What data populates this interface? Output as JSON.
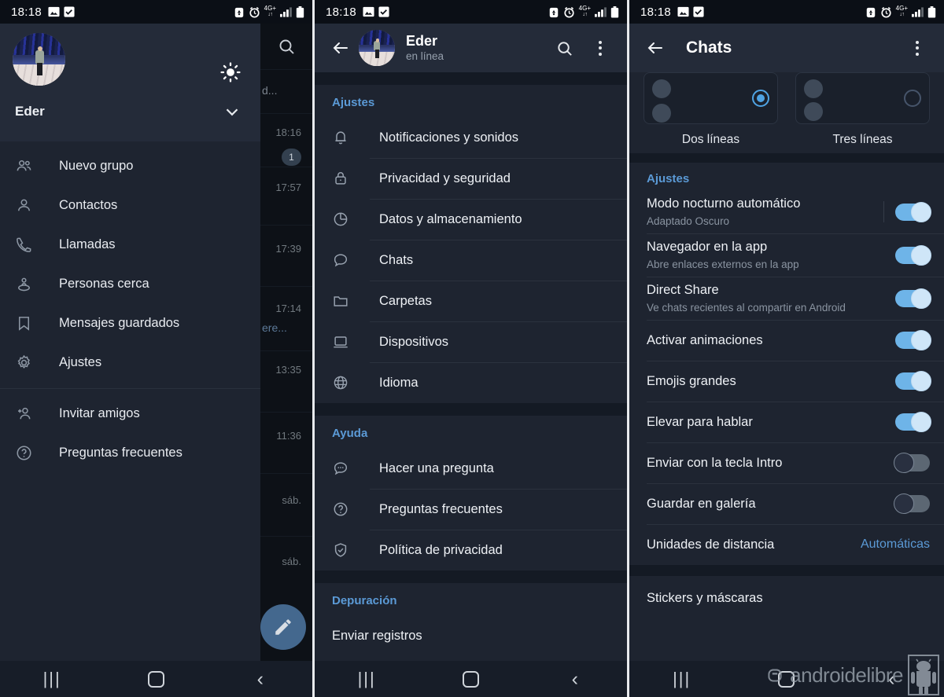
{
  "statusbar": {
    "time": "18:18",
    "left_icons": [
      "image-icon",
      "checkbox-icon"
    ],
    "right_icons": [
      "alarm-silent-icon",
      "alarm-icon",
      "mobile-data-icon",
      "signal-icon",
      "battery-icon"
    ],
    "network_label": "4G+"
  },
  "panel1": {
    "drawer": {
      "user_name": "Eder",
      "brightness_icon": "brightness-icon",
      "expand_icon": "chevron-down-icon",
      "avatar": "user-avatar",
      "items": [
        {
          "label": "Nuevo grupo",
          "icon": "group-icon"
        },
        {
          "label": "Contactos",
          "icon": "person-icon"
        },
        {
          "label": "Llamadas",
          "icon": "phone-icon"
        },
        {
          "label": "Personas cerca",
          "icon": "nearby-people-icon"
        },
        {
          "label": "Mensajes guardados",
          "icon": "bookmark-icon"
        },
        {
          "label": "Ajustes",
          "icon": "gear-icon"
        }
      ],
      "items_secondary": [
        {
          "label": "Invitar amigos",
          "icon": "person-add-icon"
        },
        {
          "label": "Preguntas frecuentes",
          "icon": "question-circle-icon"
        }
      ]
    },
    "chat_strip": {
      "search_icon": "search-icon",
      "rows": [
        {
          "time": "",
          "snippet": "d...",
          "badge": ""
        },
        {
          "time": "18:16",
          "snippet": "",
          "badge": "1"
        },
        {
          "time": "17:57",
          "snippet": "",
          "badge": ""
        },
        {
          "time": "17:39",
          "snippet": "",
          "badge": ""
        },
        {
          "time": "17:14",
          "snippet": "ere...",
          "badge": ""
        },
        {
          "time": "13:35",
          "snippet": "",
          "badge": ""
        },
        {
          "time": "11:36",
          "snippet": "",
          "badge": ""
        },
        {
          "time": "sáb.",
          "snippet": "",
          "badge": ""
        },
        {
          "time": "sáb.",
          "snippet": "",
          "badge": ""
        }
      ],
      "fab_icon": "compose-pencil-icon"
    }
  },
  "panel2": {
    "header": {
      "back_icon": "back-arrow-icon",
      "title": "Eder",
      "subtitle": "en línea",
      "search_icon": "search-icon",
      "menu_icon": "overflow-menu-icon"
    },
    "sections": [
      {
        "title": "Ajustes",
        "items": [
          {
            "label": "Notificaciones y sonidos",
            "icon": "bell-icon"
          },
          {
            "label": "Privacidad y seguridad",
            "icon": "lock-icon"
          },
          {
            "label": "Datos y almacenamiento",
            "icon": "pie-chart-icon"
          },
          {
            "label": "Chats",
            "icon": "chat-bubble-icon"
          },
          {
            "label": "Carpetas",
            "icon": "folder-icon"
          },
          {
            "label": "Dispositivos",
            "icon": "laptop-icon"
          },
          {
            "label": "Idioma",
            "icon": "globe-icon"
          }
        ]
      },
      {
        "title": "Ayuda",
        "items": [
          {
            "label": "Hacer una pregunta",
            "icon": "chat-dots-icon"
          },
          {
            "label": "Preguntas frecuentes",
            "icon": "question-circle-icon"
          },
          {
            "label": "Política de privacidad",
            "icon": "shield-check-icon"
          }
        ]
      },
      {
        "title": "Depuración",
        "items": [
          {
            "label": "Enviar registros",
            "icon": ""
          }
        ]
      }
    ]
  },
  "panel3": {
    "header": {
      "back_icon": "back-arrow-icon",
      "title": "Chats",
      "menu_icon": "overflow-menu-icon"
    },
    "chat_preview": {
      "options": [
        {
          "label": "Dos líneas",
          "selected": true,
          "lines": 2
        },
        {
          "label": "Tres líneas",
          "selected": false,
          "lines": 3
        }
      ]
    },
    "settings": {
      "title": "Ajustes",
      "rows": [
        {
          "label": "Modo nocturno automático",
          "sub": "Adaptado Oscuro",
          "control": "toggle",
          "state": "on",
          "divider": true
        },
        {
          "label": "Navegador en la app",
          "sub": "Abre enlaces externos en la app",
          "control": "toggle",
          "state": "on",
          "divider": false
        },
        {
          "label": "Direct Share",
          "sub": "Ve chats recientes al compartir en Android",
          "control": "toggle",
          "state": "on",
          "divider": false
        },
        {
          "label": "Activar animaciones",
          "sub": "",
          "control": "toggle",
          "state": "on",
          "divider": false
        },
        {
          "label": "Emojis grandes",
          "sub": "",
          "control": "toggle",
          "state": "on",
          "divider": false
        },
        {
          "label": "Elevar para hablar",
          "sub": "",
          "control": "toggle",
          "state": "on",
          "divider": false
        },
        {
          "label": "Enviar con la tecla Intro",
          "sub": "",
          "control": "toggle",
          "state": "off",
          "divider": false
        },
        {
          "label": "Guardar en galería",
          "sub": "",
          "control": "toggle",
          "state": "off",
          "divider": false
        },
        {
          "label": "Unidades de distancia",
          "sub": "",
          "control": "value",
          "value": "Automáticas",
          "divider": false
        }
      ]
    },
    "stickers": {
      "label": "Stickers y máscaras"
    }
  },
  "navbar": {
    "recent_icon": "recent-apps-icon",
    "home_icon": "home-icon",
    "back_icon": "back-icon"
  },
  "watermark": {
    "text": "androidelibre",
    "logo_icon": "android-robot-icon"
  },
  "colors": {
    "accent": "#5b9ad6",
    "toggle_on": "#6eb4e8",
    "panel_bg": "#1e2430",
    "header_bg": "#242b39",
    "dark_bg": "#0d1117"
  }
}
